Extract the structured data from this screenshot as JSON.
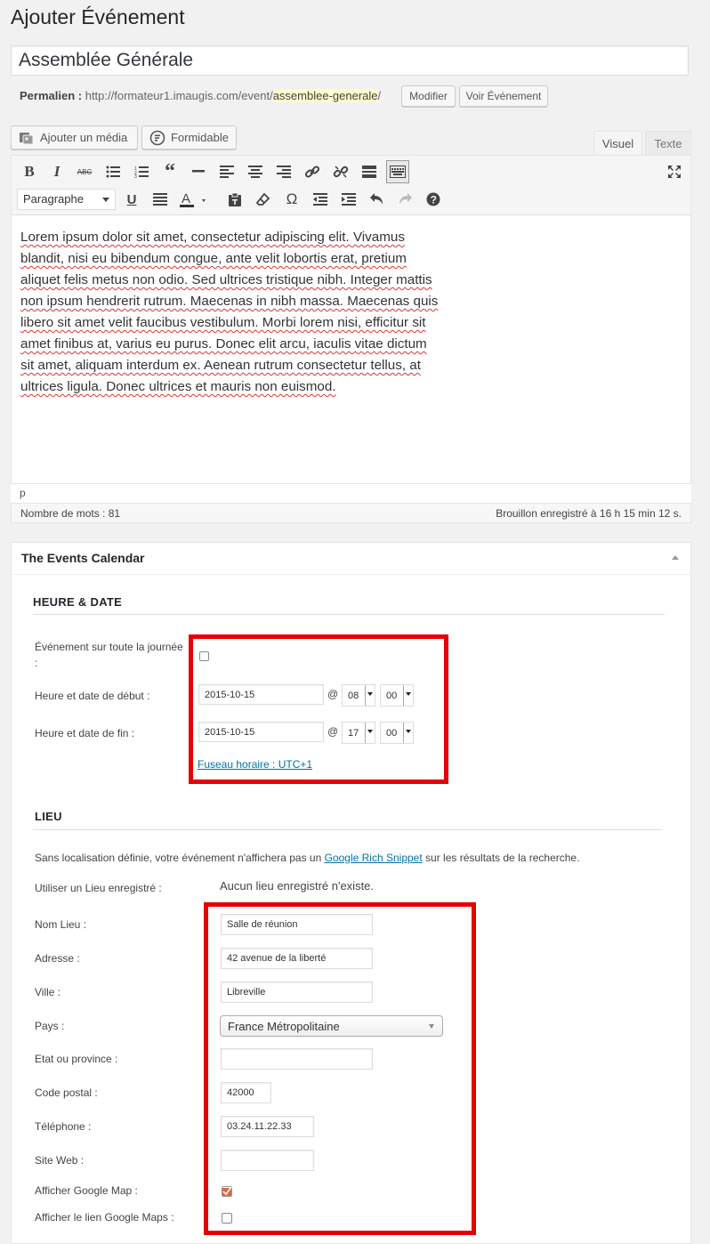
{
  "page": {
    "title": "Ajouter Événement"
  },
  "post": {
    "title_value": "Assemblée Générale",
    "permalink_label": "Permalien :",
    "permalink_base": "http://formateur1.imaugis.com/event/",
    "permalink_slug": "assemblee-generale",
    "permalink_end": "/",
    "modify_label": "Modifier",
    "view_label": "Voir Événement"
  },
  "media": {
    "add_media_label": "Ajouter un média",
    "formidable_label": "Formidable"
  },
  "editor_tabs": {
    "visual": "Visuel",
    "text": "Texte"
  },
  "toolbar": {
    "format_select": "Paragraphe",
    "icons": [
      "bold-icon",
      "italic-icon",
      "strikethrough-icon",
      "bullet-list-icon",
      "numbered-list-icon",
      "blockquote-icon",
      "horizontal-line-icon",
      "align-left-icon",
      "align-center-icon",
      "align-right-icon",
      "link-icon",
      "unlink-icon",
      "read-more-icon",
      "toolbar-toggle-icon",
      "fullscreen-icon",
      "underline-icon",
      "justify-icon",
      "text-color-icon",
      "paste-text-icon",
      "clear-format-icon",
      "special-char-icon",
      "outdent-icon",
      "indent-icon",
      "undo-icon",
      "redo-icon",
      "help-icon"
    ]
  },
  "content": {
    "lines": [
      "Lorem ipsum dolor sit amet, consectetur adipiscing elit. Vivamus",
      "blandit, nisi eu bibendum congue, ante velit lobortis erat, pretium",
      "aliquet felis metus non odio. Sed ultrices tristique nibh. Integer mattis",
      "non ipsum hendrerit rutrum. Maecenas in nibh massa. Maecenas quis",
      "libero sit amet velit faucibus vestibulum. Morbi lorem nisi, efficitur sit",
      "amet finibus at, varius eu purus. Donec elit arcu, iaculis vitae dictum",
      "sit amet, aliquam interdum ex. Aenean rutrum consectetur tellus, at",
      "ultrices ligula. Donec ultrices et mauris non euismod."
    ],
    "path": "p",
    "word_count": "Nombre de mots : 81",
    "draft_saved": "Brouillon enregistré à 16 h 15 min 12 s."
  },
  "events": {
    "box_title": "The Events Calendar",
    "datetime": {
      "section_title": "HEURE & DATE",
      "all_day_label_1": "Événement sur toute la journée",
      "all_day_label_2": ":",
      "all_day_checked": false,
      "start_label": "Heure et date de début :",
      "start_date": "2015-10-15",
      "start_hour": "08",
      "start_min": "00",
      "end_label": "Heure et date de fin :",
      "end_date": "2015-10-15",
      "end_hour": "17",
      "end_min": "00",
      "at": "@",
      "timezone_link": "Fuseau horaire : UTC+1"
    },
    "venue": {
      "section_title": "LIEU",
      "notice_before": "Sans localisation définie, votre événement n'affichera pas un ",
      "notice_link": "Google Rich Snippet",
      "notice_after": " sur les résultats de la recherche.",
      "saved_venue_label": "Utiliser un Lieu enregistré :",
      "saved_venue_value": "Aucun lieu enregistré n'existe.",
      "name_label": "Nom Lieu :",
      "name_value": "Salle de réunion",
      "address_label": "Adresse :",
      "address_value": "42 avenue de la liberté",
      "city_label": "Ville :",
      "city_value": "Libreville",
      "country_label": "Pays :",
      "country_value": "France Métropolitaine",
      "state_label": "Etat ou province :",
      "state_value": "",
      "zip_label": "Code postal :",
      "zip_value": "42000",
      "phone_label": "Téléphone :",
      "phone_value": "03.24.11.22.33",
      "website_label": "Site Web :",
      "website_value": "",
      "show_map_label": "Afficher Google Map :",
      "show_map_checked": true,
      "show_map_link_label": "Afficher le lien Google Maps :",
      "show_map_link_checked": false
    }
  },
  "colors": {
    "highlight_box": "#e60000",
    "link": "#0073aa",
    "map_checkbox": "#d54e21"
  }
}
